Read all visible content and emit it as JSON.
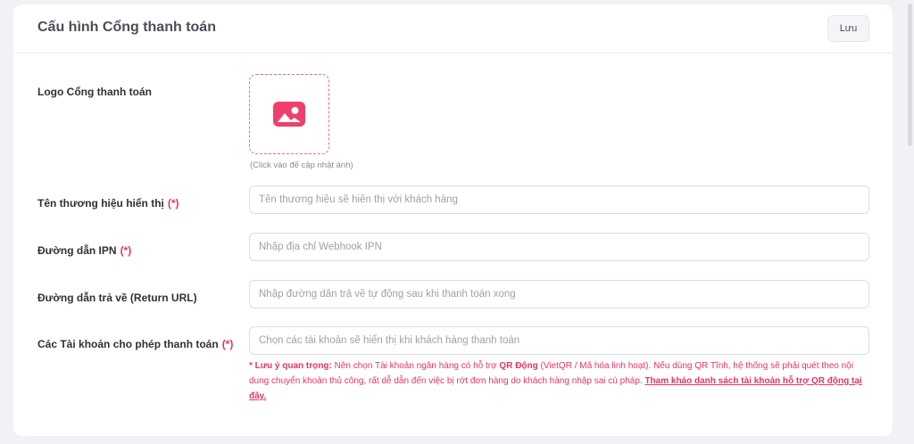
{
  "header": {
    "title": "Cấu hình Cổng thanh toán",
    "save_label": "Lưu"
  },
  "logo": {
    "label": "Logo Cổng thanh toán",
    "hint": "(Click vào để cập nhật ảnh)",
    "icon": "image-icon",
    "icon_color": "#ef3f6d"
  },
  "brand_name": {
    "label": "Tên thương hiệu hiển thị",
    "required": "(*)",
    "value": "",
    "placeholder": "Tên thương hiệu sẽ hiển thị với khách hàng"
  },
  "ipn": {
    "label": "Đường dẫn IPN",
    "required": "(*)",
    "value": "",
    "placeholder": "Nhập địa chỉ Webhook IPN"
  },
  "return_url": {
    "label": "Đường dẫn trả về (Return URL)",
    "value": "",
    "placeholder": "Nhập đường dẫn trả về tự động sau khi thanh toán xong"
  },
  "accounts": {
    "label": "Các Tài khoản cho phép thanh toán",
    "required": "(*)",
    "placeholder": "Chọn các tài khoản sẽ hiển thị khi khách hàng thanh toán"
  },
  "note": {
    "prefix": "* Lưu ý quan trọng:",
    "text1": " Nên chọn Tài khoản ngân hàng có hỗ trợ ",
    "highlight": "QR Động",
    "text2": " (VietQR / Mã hóa linh hoạt). Nếu dùng QR Tĩnh, hệ thống sẽ phải quét theo nội dung chuyển khoản thủ công, rất dễ dẫn đến việc bị rớt đơn hàng do khách hàng nhập sai cú pháp. ",
    "link": "Tham khảo danh sách tài khoản hỗ trợ QR động tại đây."
  },
  "colors": {
    "accent": "#e8336a",
    "background": "#f1f2f5"
  }
}
